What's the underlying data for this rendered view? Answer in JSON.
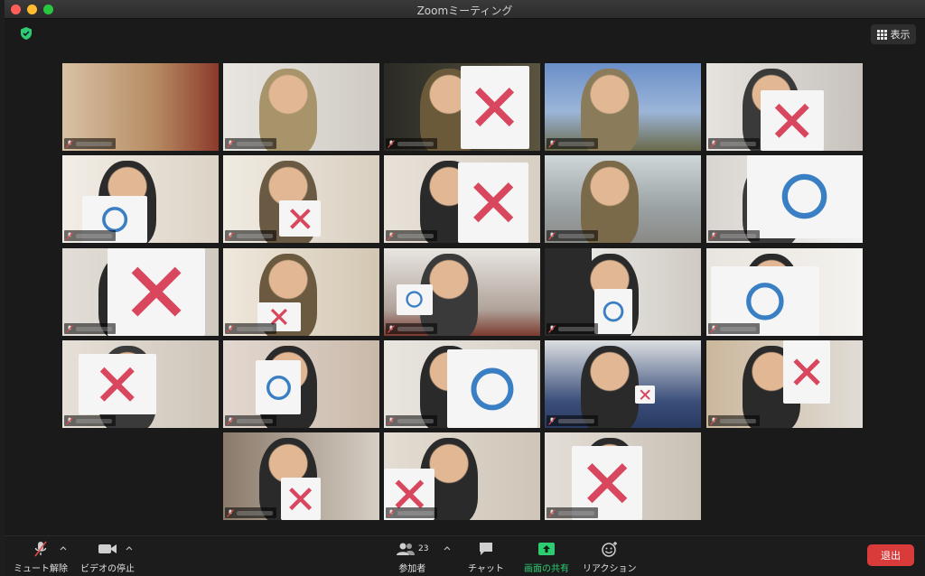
{
  "window": {
    "title": "Zoomミーティング"
  },
  "topbar": {
    "view_label": "表示"
  },
  "toolbar": {
    "mute_label": "ミュート解除",
    "video_label": "ビデオの停止",
    "participants_label": "参加者",
    "participants_count": "23",
    "chat_label": "チャット",
    "share_label": "画面の共有",
    "reactions_label": "リアクション",
    "leave_label": "退出"
  },
  "colors": {
    "active_speaker_border": "#d6e85c",
    "leave_button": "#d93a3a",
    "share_icon": "#2ecc71",
    "mark_cross": "#d9475f",
    "mark_circle": "#3a7fc4"
  }
}
